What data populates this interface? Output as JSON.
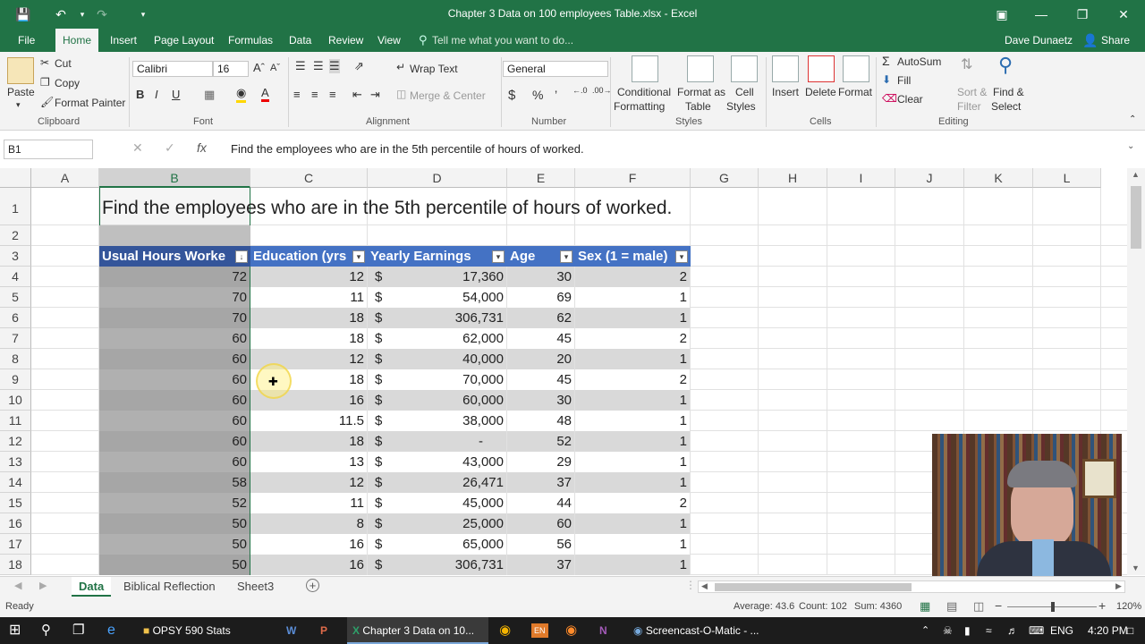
{
  "window": {
    "title": "Chapter 3 Data on 100 employees Table.xlsx - Excel"
  },
  "menu": {
    "tabs": [
      "File",
      "Home",
      "Insert",
      "Page Layout",
      "Formulas",
      "Data",
      "Review",
      "View"
    ],
    "tell_me": "Tell me what you want to do...",
    "user": "Dave Dunaetz",
    "share": "Share"
  },
  "ribbon": {
    "clipboard": {
      "label": "Clipboard",
      "paste": "Paste",
      "cut": "Cut",
      "copy": "Copy",
      "format_painter": "Format Painter"
    },
    "font": {
      "label": "Font",
      "name": "Calibri",
      "size": "16"
    },
    "alignment": {
      "label": "Alignment",
      "wrap": "Wrap Text",
      "merge": "Merge & Center"
    },
    "number": {
      "label": "Number",
      "format": "General"
    },
    "styles": {
      "label": "Styles",
      "cond1": "Conditional",
      "cond2": "Formatting",
      "fat1": "Format as",
      "fat2": "Table",
      "cs1": "Cell",
      "cs2": "Styles"
    },
    "cells": {
      "label": "Cells",
      "insert": "Insert",
      "delete": "Delete",
      "format": "Format"
    },
    "editing": {
      "label": "Editing",
      "autosum": "AutoSum",
      "fill": "Fill",
      "clear": "Clear",
      "sort1": "Sort &",
      "sort2": "Filter",
      "find1": "Find &",
      "find2": "Select"
    }
  },
  "formula_bar": {
    "name_box": "B1",
    "content": "Find the employees who are in the 5th percentile of hours of worked."
  },
  "grid": {
    "columns": [
      "A",
      "B",
      "C",
      "D",
      "E",
      "F",
      "G",
      "H",
      "I",
      "J",
      "K",
      "L"
    ],
    "rows": [
      "1",
      "2",
      "3",
      "4",
      "5",
      "6",
      "7",
      "8",
      "9",
      "10",
      "11",
      "12",
      "13",
      "14",
      "15",
      "16",
      "17",
      "18"
    ],
    "title_text": "Find the employees who are in the 5th percentile of hours of worked.",
    "headers": [
      "Usual Hours Worke",
      "Education (yrs",
      "Yearly Earnings",
      "Age",
      "Sex (1 = male)"
    ],
    "currency_symbol": "$",
    "data": [
      [
        "72",
        "12",
        "17,360",
        "30",
        "2"
      ],
      [
        "70",
        "11",
        "54,000",
        "69",
        "1"
      ],
      [
        "70",
        "18",
        "306,731",
        "62",
        "1"
      ],
      [
        "60",
        "18",
        "62,000",
        "45",
        "2"
      ],
      [
        "60",
        "12",
        "40,000",
        "20",
        "1"
      ],
      [
        "60",
        "18",
        "70,000",
        "45",
        "2"
      ],
      [
        "60",
        "16",
        "60,000",
        "30",
        "1"
      ],
      [
        "60",
        "11.5",
        "38,000",
        "48",
        "1"
      ],
      [
        "60",
        "18",
        "-",
        "52",
        "1"
      ],
      [
        "60",
        "13",
        "43,000",
        "29",
        "1"
      ],
      [
        "58",
        "12",
        "26,471",
        "37",
        "1"
      ],
      [
        "52",
        "11",
        "45,000",
        "44",
        "2"
      ],
      [
        "50",
        "8",
        "25,000",
        "60",
        "1"
      ],
      [
        "50",
        "16",
        "65,000",
        "56",
        "1"
      ],
      [
        "50",
        "16",
        "306,731",
        "37",
        "1"
      ]
    ]
  },
  "sheets": [
    "Data",
    "Biblical Reflection",
    "Sheet3"
  ],
  "status": {
    "ready": "Ready",
    "average": "Average: 43.6",
    "count": "Count: 102",
    "sum": "Sum: 4360",
    "zoom": "120%"
  },
  "taskbar": {
    "items": [
      "OPSY 590 Stats",
      "Chapter 3 Data on 10...",
      "Screencast-O-Matic - ..."
    ],
    "lang": "ENG",
    "time": "4:20 PM",
    "en_badge": "EN"
  }
}
